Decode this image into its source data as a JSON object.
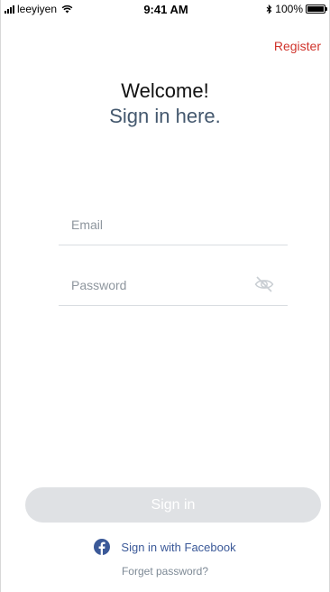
{
  "status_bar": {
    "carrier": "leeyiyen",
    "time": "9:41 AM",
    "battery": "100%"
  },
  "header": {
    "register_label": "Register"
  },
  "welcome": {
    "title": "Welcome!",
    "subtitle": "Sign in here."
  },
  "form": {
    "email_placeholder": "Email",
    "password_placeholder": "Password",
    "signin_label": "Sign in"
  },
  "footer": {
    "facebook_label": "Sign in with Facebook",
    "forget_label": "Forget password?"
  },
  "icons": {
    "signal": "signal-bars-icon",
    "wifi": "wifi-icon",
    "bluetooth": "bluetooth-icon",
    "battery": "battery-icon",
    "password_toggle": "eye-slash-icon",
    "facebook": "facebook-icon"
  },
  "colors": {
    "accent_register": "#d0342c",
    "subtitle": "#44586e",
    "facebook": "#3b5998",
    "button_disabled": "#dfe1e4"
  }
}
